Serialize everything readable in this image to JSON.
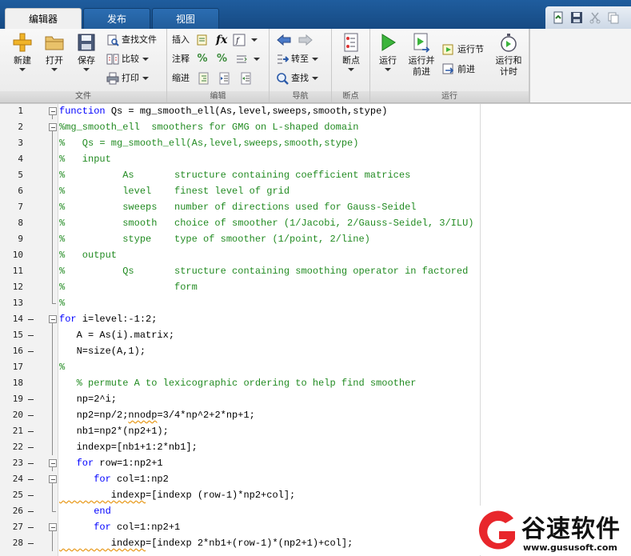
{
  "tabs": [
    {
      "label": "编辑器",
      "active": true
    },
    {
      "label": "发布",
      "active": false
    },
    {
      "label": "视图",
      "active": false
    }
  ],
  "ribbon": {
    "file": {
      "section_label": "文件",
      "new_label": "新建",
      "open_label": "打开",
      "save_label": "保存",
      "find_files_label": "查找文件",
      "compare_label": "比较",
      "print_label": "打印"
    },
    "edit": {
      "section_label": "编辑",
      "insert_label": "插入",
      "comment_label": "注释",
      "indent_label": "缩进",
      "fx_label": "fx"
    },
    "navigate": {
      "section_label": "导航",
      "goto_label": "转至",
      "find_label": "查找"
    },
    "breakpoints": {
      "section_label": "断点",
      "breakpoints_label": "断点"
    },
    "run": {
      "section_label": "运行",
      "run_label": "运行",
      "run_advance_label_1": "运行并",
      "run_advance_label_2": "前进",
      "run_section_label": "运行节",
      "advance_label": "前进",
      "run_time_label_1": "运行和",
      "run_time_label_2": "计时"
    }
  },
  "code": {
    "lines": [
      {
        "n": "1",
        "dash": false,
        "fold": "box",
        "parts": [
          [
            "kw",
            "function"
          ],
          [
            "",
            "Qs = mg_smooth_ell(As,level,sweeps,smooth,stype)"
          ]
        ]
      },
      {
        "n": "2",
        "dash": false,
        "fold": "box",
        "parts": [
          [
            "cm",
            "%mg_smooth_ell  smoothers for GMG on L-shaped domain"
          ]
        ]
      },
      {
        "n": "3",
        "dash": false,
        "fold": "line",
        "parts": [
          [
            "cm",
            "%   Qs = mg_smooth_ell(As,level,sweeps,smooth,stype)"
          ]
        ]
      },
      {
        "n": "4",
        "dash": false,
        "fold": "line",
        "parts": [
          [
            "cm",
            "%   input"
          ]
        ]
      },
      {
        "n": "5",
        "dash": false,
        "fold": "line",
        "parts": [
          [
            "cm",
            "%          As       structure containing coefficient matrices"
          ]
        ]
      },
      {
        "n": "6",
        "dash": false,
        "fold": "line",
        "parts": [
          [
            "cm",
            "%          level    finest level of grid"
          ]
        ]
      },
      {
        "n": "7",
        "dash": false,
        "fold": "line",
        "parts": [
          [
            "cm",
            "%          sweeps   number of directions used for Gauss-Seidel"
          ]
        ]
      },
      {
        "n": "8",
        "dash": false,
        "fold": "line",
        "parts": [
          [
            "cm",
            "%          smooth   choice of smoother (1/Jacobi, 2/Gauss-Seidel, 3/ILU)"
          ]
        ]
      },
      {
        "n": "9",
        "dash": false,
        "fold": "line",
        "parts": [
          [
            "cm",
            "%          stype    type of smoother (1/point, 2/line)"
          ]
        ]
      },
      {
        "n": "10",
        "dash": false,
        "fold": "line",
        "parts": [
          [
            "cm",
            "%   output"
          ]
        ]
      },
      {
        "n": "11",
        "dash": false,
        "fold": "line",
        "parts": [
          [
            "cm",
            "%          Qs       structure containing smoothing operator in factored"
          ]
        ]
      },
      {
        "n": "12",
        "dash": false,
        "fold": "line",
        "parts": [
          [
            "cm",
            "%                   form"
          ]
        ]
      },
      {
        "n": "13",
        "dash": false,
        "fold": "end",
        "parts": [
          [
            "cm",
            "%"
          ]
        ]
      },
      {
        "n": "14",
        "dash": true,
        "fold": "box",
        "parts": [
          [
            "kw",
            "for"
          ],
          [
            "",
            "i=level:-1:2;"
          ]
        ]
      },
      {
        "n": "15",
        "dash": true,
        "fold": "line",
        "parts": [
          [
            "",
            "   A = As(i).matrix;"
          ]
        ]
      },
      {
        "n": "16",
        "dash": true,
        "fold": "line",
        "parts": [
          [
            "",
            "   N=size(A,1);"
          ]
        ]
      },
      {
        "n": "17",
        "dash": false,
        "fold": "line",
        "parts": [
          [
            "cm",
            "%"
          ]
        ]
      },
      {
        "n": "18",
        "dash": false,
        "fold": "line",
        "parts": [
          [
            "cm",
            "   % permute A to lexicographic ordering to help find smoother"
          ]
        ]
      },
      {
        "n": "19",
        "dash": true,
        "fold": "line",
        "parts": [
          [
            "",
            "   np=2^i;"
          ]
        ]
      },
      {
        "n": "20",
        "dash": true,
        "fold": "line",
        "parts": [
          [
            "",
            "   np2=np/2;"
          ],
          [
            "sq",
            "nnodp"
          ],
          [
            "",
            "=3/4*np^2+2*np+1;"
          ]
        ]
      },
      {
        "n": "21",
        "dash": true,
        "fold": "line",
        "parts": [
          [
            "",
            "   nb1=np2*(np2+1);"
          ]
        ]
      },
      {
        "n": "22",
        "dash": true,
        "fold": "line",
        "parts": [
          [
            "",
            "   indexp=[nb1+1:2*nb1];"
          ]
        ]
      },
      {
        "n": "23",
        "dash": true,
        "fold": "box",
        "parts": [
          [
            "kw",
            "   for"
          ],
          [
            "",
            "row=1:np2+1"
          ]
        ]
      },
      {
        "n": "24",
        "dash": true,
        "fold": "box",
        "parts": [
          [
            "kw",
            "      for"
          ],
          [
            "",
            "col=1:np2"
          ]
        ]
      },
      {
        "n": "25",
        "dash": true,
        "fold": "line",
        "parts": [
          [
            "sq",
            "         indexp"
          ],
          [
            "",
            "=[indexp (row-1)*np2+col];"
          ]
        ]
      },
      {
        "n": "26",
        "dash": true,
        "fold": "end",
        "parts": [
          [
            "kw",
            "      end"
          ]
        ]
      },
      {
        "n": "27",
        "dash": true,
        "fold": "box",
        "parts": [
          [
            "kw",
            "      for"
          ],
          [
            "",
            "col=1:np2+1"
          ]
        ]
      },
      {
        "n": "28",
        "dash": true,
        "fold": "line",
        "parts": [
          [
            "sq",
            "         indexp"
          ],
          [
            "",
            "=[indexp 2*nb1+(row-1)*(np2+1)+col];"
          ]
        ]
      }
    ]
  },
  "watermark": {
    "brand_cn": "谷速软件",
    "url": "www.gususoft.com"
  },
  "colors": {
    "keyword": "#0000ff",
    "comment": "#228b22",
    "tabbar": "#1f5d9e",
    "watermark_red": "#e8262b"
  }
}
